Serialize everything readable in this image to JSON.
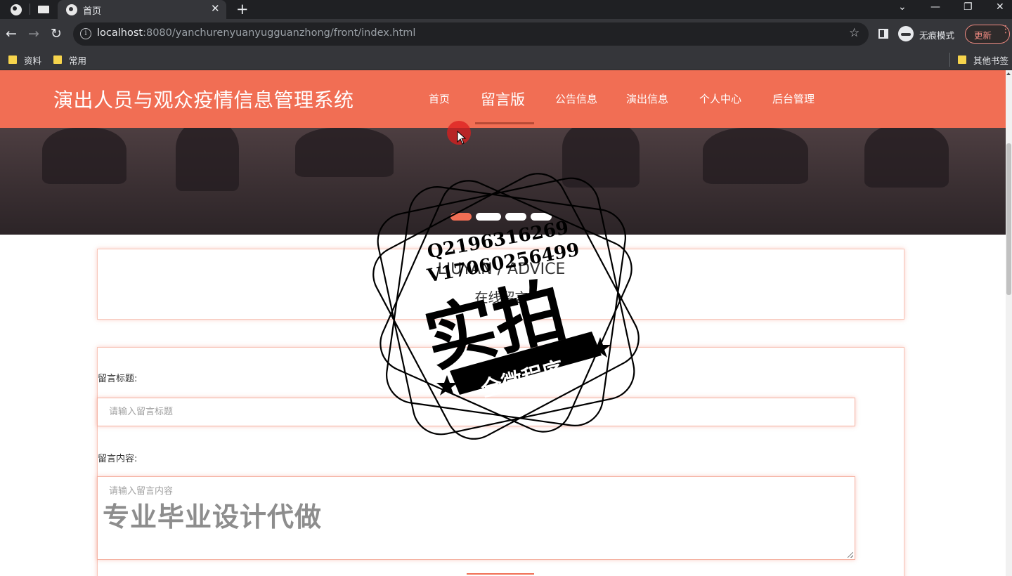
{
  "browser": {
    "tab_title": "首页",
    "close_glyph": "✕",
    "new_tab_glyph": "+",
    "url_host": "localhost",
    "url_rest": ":8080/yanchurenyuanyugguanzhong/front/index.html",
    "incognito_label": "无痕模式",
    "update_label": "更新",
    "bookmarks": [
      {
        "label": "资料"
      },
      {
        "label": "常用"
      }
    ],
    "other_bookmarks": "其他书签"
  },
  "site": {
    "title": "演出人员与观众疫情信息管理系统",
    "nav": [
      {
        "label": "首页"
      },
      {
        "label": "留言版"
      },
      {
        "label": "公告信息"
      },
      {
        "label": "演出信息"
      },
      {
        "label": "个人中心"
      },
      {
        "label": "后台管理"
      }
    ],
    "active_nav": "留言版"
  },
  "section": {
    "title_en": "LIUYAN / ADVICE",
    "title_cn": "在线留言"
  },
  "form": {
    "title_label": "留言标题:",
    "title_placeholder": "请输入留言标题",
    "content_label": "留言内容:",
    "content_placeholder": "请输入留言内容"
  },
  "watermark": {
    "text": "专业毕业设计代做",
    "stamp_line1": "Q2196316269",
    "stamp_line2": "V17060256499",
    "stamp_main": "实拍",
    "stamp_ribbon": "全微程序"
  },
  "colors": {
    "accent": "#f16e54",
    "browser_dark": "#35363a"
  }
}
